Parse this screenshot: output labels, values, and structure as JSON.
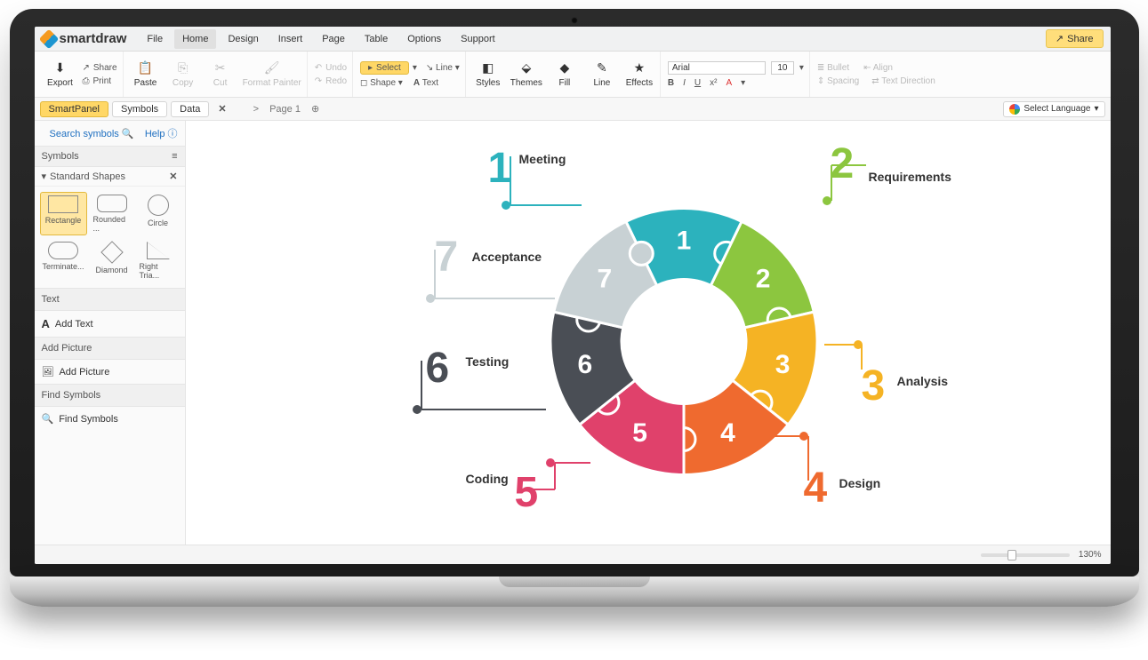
{
  "app": {
    "name": "smartdraw"
  },
  "menu": {
    "items": [
      "File",
      "Home",
      "Design",
      "Insert",
      "Page",
      "Table",
      "Options",
      "Support"
    ],
    "active": 1,
    "share": "Share"
  },
  "ribbon": {
    "export": "Export",
    "print": "Print",
    "share": "Share",
    "paste": "Paste",
    "copy": "Copy",
    "cut": "Cut",
    "format_painter": "Format Painter",
    "undo": "Undo",
    "redo": "Redo",
    "select": "Select",
    "shape": "Shape",
    "line": "Line",
    "text": "Text",
    "styles": "Styles",
    "themes": "Themes",
    "fill": "Fill",
    "lineBtn": "Line",
    "effects": "Effects",
    "font_name": "Arial",
    "font_size": "10",
    "bullet": "Bullet",
    "align": "Align",
    "spacing": "Spacing",
    "text_direction": "Text Direction"
  },
  "tabs": {
    "side": [
      "SmartPanel",
      "Symbols",
      "Data"
    ],
    "side_active": 0,
    "page_label": "Page 1",
    "language": "Select Language"
  },
  "sidebar": {
    "search": "Search symbols",
    "help": "Help",
    "symbols_header": "Symbols",
    "shapes_header": "Standard Shapes",
    "shapes": [
      "Rectangle",
      "Rounded ...",
      "Circle",
      "Terminate...",
      "Diamond",
      "Right Tria..."
    ],
    "text_header": "Text",
    "add_text": "Add Text",
    "picture_header": "Add Picture",
    "add_picture": "Add Picture",
    "find_header": "Find Symbols",
    "find_symbols": "Find Symbols"
  },
  "status": {
    "zoom": "130%"
  },
  "chart_data": {
    "type": "pie",
    "title": "",
    "segments": [
      {
        "n": 1,
        "label": "Meeting",
        "color": "#2cb2bd"
      },
      {
        "n": 2,
        "label": "Requirements",
        "color": "#8cc63f"
      },
      {
        "n": 3,
        "label": "Analysis",
        "color": "#f5b324"
      },
      {
        "n": 4,
        "label": "Design",
        "color": "#ef6a2f"
      },
      {
        "n": 5,
        "label": "Coding",
        "color": "#e0416b"
      },
      {
        "n": 6,
        "label": "Testing",
        "color": "#4a4e55"
      },
      {
        "n": 7,
        "label": "Acceptance",
        "color": "#c8d1d4"
      }
    ]
  }
}
